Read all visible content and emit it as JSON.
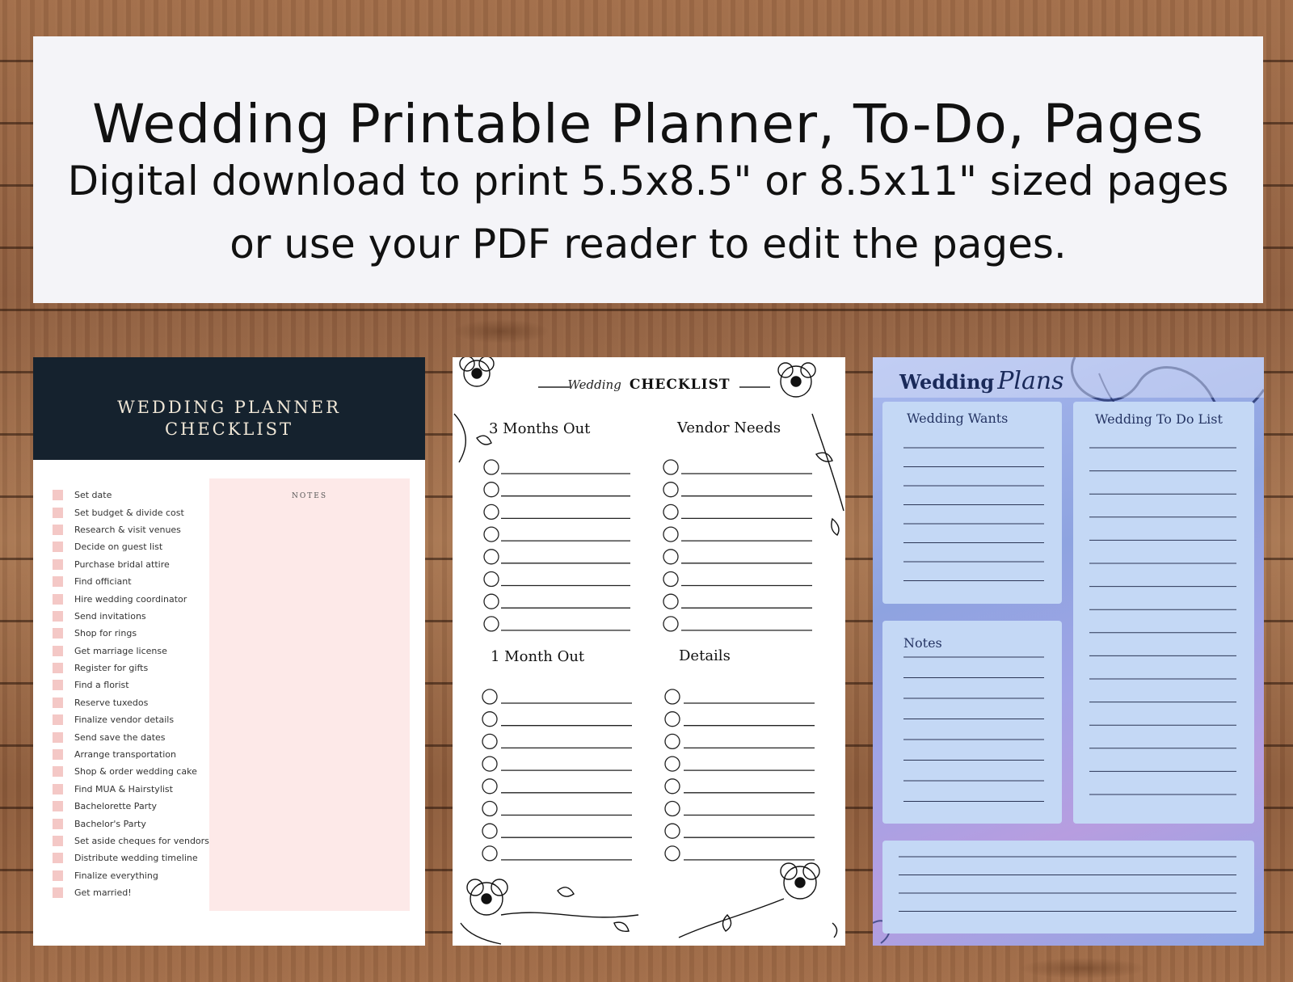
{
  "banner": {
    "title": "Wedding Printable Planner, To-Do, Pages",
    "subtitle_line1": "Digital download to print 5.5x8.5\" or 8.5x11\" sized pages",
    "subtitle_line2": "or use your PDF reader to edit the pages."
  },
  "panel1": {
    "header_line1": "WEDDING PLANNER",
    "header_line2": "CHECKLIST",
    "notes_label": "NOTES",
    "items": [
      "Set date",
      "Set budget & divide cost",
      "Research & visit venues",
      "Decide on guest list",
      "Purchase bridal attire",
      "Find officiant",
      "Hire wedding coordinator",
      "Send invitations",
      "Shop for rings",
      "Get marriage license",
      "Register for gifts",
      "Find a florist",
      "Reserve tuxedos",
      "Finalize vendor details",
      "Send save the dates",
      "Arrange transportation",
      "Shop & order wedding cake",
      "Find MUA & Hairstylist",
      "Bachelorette Party",
      "Bachelor's Party",
      "Set aside cheques for vendors",
      "Distribute wedding timeline",
      "Finalize everything",
      "Get married!"
    ]
  },
  "panel2": {
    "title_script": "Wedding",
    "title_main": "CHECKLIST",
    "sections": [
      "3 Months Out",
      "Vendor Needs",
      "1 Month Out",
      "Details"
    ]
  },
  "panel3": {
    "title_word": "Wedding",
    "title_script": "Plans",
    "wants_label": "Wedding Wants",
    "todo_label": "Wedding To Do List",
    "notes_label": "Notes"
  },
  "colors": {
    "banner_bg": "#f4f4f8",
    "panel1_header": "#15222e",
    "panel1_checkbox": "#f4c8c6",
    "panel1_notes_bg": "#fde9e8",
    "panel3_box": "#c4d8f5",
    "panel3_text": "#253463"
  }
}
